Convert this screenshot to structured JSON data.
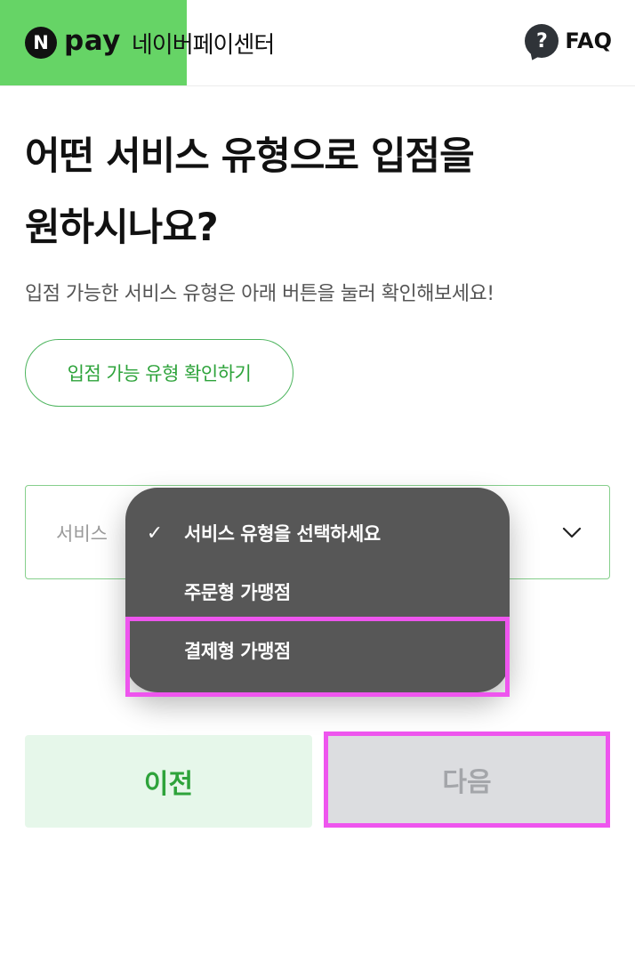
{
  "header": {
    "logo_letter": "N",
    "logo_word": "pay",
    "center_name": "네이버페이센터",
    "faq_label": "FAQ",
    "faq_icon_glyph": "?",
    "green_color": "#66d466"
  },
  "main": {
    "title_line1": "어떤 서비스 유형으로 입점을",
    "title_line2": "원하시나요?",
    "subtitle": "입점 가능한 서비스 유형은 아래 버튼을 눌러 확인해보세요!",
    "check_button_label": "입점 가능 유형 확인하기",
    "select_visible_text": "서비스",
    "select_icon": "chevron-down-icon"
  },
  "dropdown": {
    "items": [
      {
        "label": "서비스 유형을 선택하세요",
        "checked": true
      },
      {
        "label": "주문형 가맹점",
        "checked": false
      },
      {
        "label": "결제형 가맹점",
        "checked": false
      }
    ],
    "check_glyph": "✓",
    "highlight_color": "#ee55ee"
  },
  "buttons": {
    "prev_label": "이전",
    "next_label": "다음"
  },
  "colors": {
    "accent_green": "#2ea33b",
    "prev_bg": "#e6f7ea",
    "next_bg": "#dcdde0",
    "dropdown_bg": "#575757"
  }
}
